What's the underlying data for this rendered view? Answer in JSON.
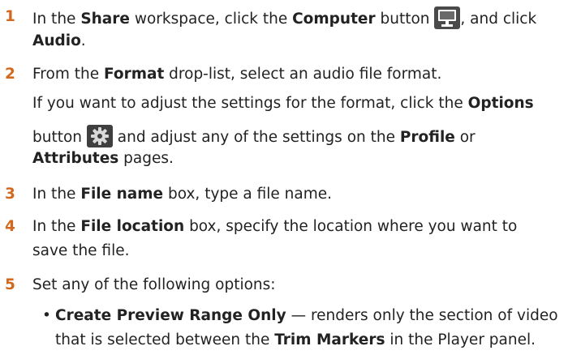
{
  "steps": [
    {
      "number": "1",
      "line1": {
        "t1": "In the ",
        "b1": "Share",
        "t2": " workspace, click the ",
        "b2": "Computer",
        "t3": " button ",
        "t4": ", and click"
      },
      "line2": {
        "b1": "Audio",
        "t1": "."
      }
    },
    {
      "number": "2",
      "line1": {
        "t1": "From the ",
        "b1": "Format",
        "t2": " drop-list, select an audio file format."
      },
      "line2": {
        "t1": "If you want to adjust the settings for the format, click the ",
        "b1": "Options"
      },
      "line3": {
        "t1": "button ",
        "t2": " and adjust any of the settings on the ",
        "b1": "Profile",
        "t3": " or"
      },
      "line4": {
        "b1": "Attributes",
        "t1": " pages."
      }
    },
    {
      "number": "3",
      "line1": {
        "t1": "In the ",
        "b1": "File name",
        "t2": " box, type a file name."
      }
    },
    {
      "number": "4",
      "line1": {
        "t1": "In the ",
        "b1": "File location",
        "t2": " box, specify the location where you want to"
      },
      "line2": {
        "t1": "save the file."
      }
    },
    {
      "number": "5",
      "line1": {
        "t1": "Set any of the following options:"
      },
      "bullet": {
        "dot": "•",
        "b1": "Create Preview Range Only",
        "t1": " — renders only the section of video",
        "t2": "that is selected between the ",
        "b2": "Trim Markers",
        "t3": " in the Player panel."
      }
    }
  ],
  "icons": {
    "computer": "computer-monitor-icon",
    "options": "gear-icon"
  },
  "colors": {
    "step_number": "#d2691e",
    "text": "#222222",
    "icon_bg": "#444444"
  }
}
